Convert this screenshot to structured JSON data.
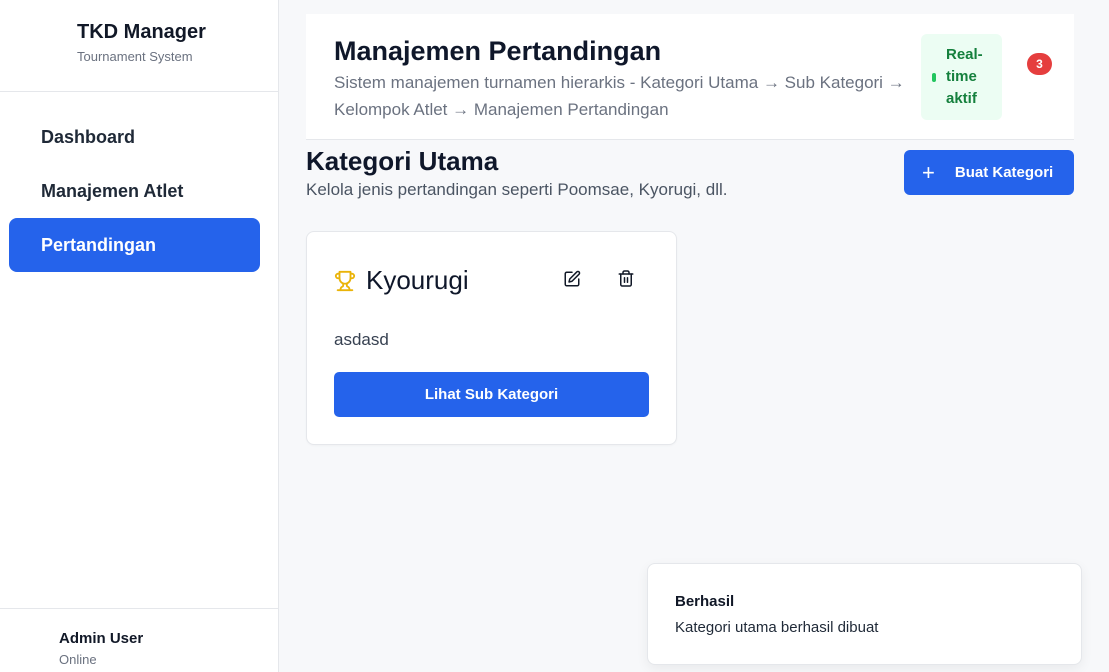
{
  "sidebar": {
    "brand_title": "TKD Manager",
    "brand_subtitle": "Tournament System",
    "items": [
      {
        "label": "Dashboard",
        "active": false
      },
      {
        "label": "Manajemen Atlet",
        "active": false
      },
      {
        "label": "Pertandingan",
        "active": true
      }
    ],
    "user": {
      "name": "Admin User",
      "status": "Online"
    }
  },
  "header": {
    "title": "Manajemen Pertandingan",
    "description": "Sistem manajemen turnamen hierarkis - Kategori Utama → Sub Kategori → Kelompok Atlet → Manajemen Pertandingan",
    "realtime_label": "Real-time aktif",
    "notification_count": "3"
  },
  "section": {
    "title": "Kategori Utama",
    "description": "Kelola jenis pertandingan seperti Poomsae, Kyorugi, dll.",
    "create_button": "Buat Kategori"
  },
  "categories": [
    {
      "name": "Kyourugi",
      "description": "asdasd",
      "action_label": "Lihat Sub Kategori",
      "icon": "trophy-icon"
    }
  ],
  "toast": {
    "title": "Berhasil",
    "message": "Kategori utama berhasil dibuat"
  },
  "colors": {
    "primary": "#2563eb",
    "success_bg": "#ecfdf3",
    "success_text": "#15803d",
    "badge": "#e53e3e",
    "trophy": "#eab308"
  }
}
